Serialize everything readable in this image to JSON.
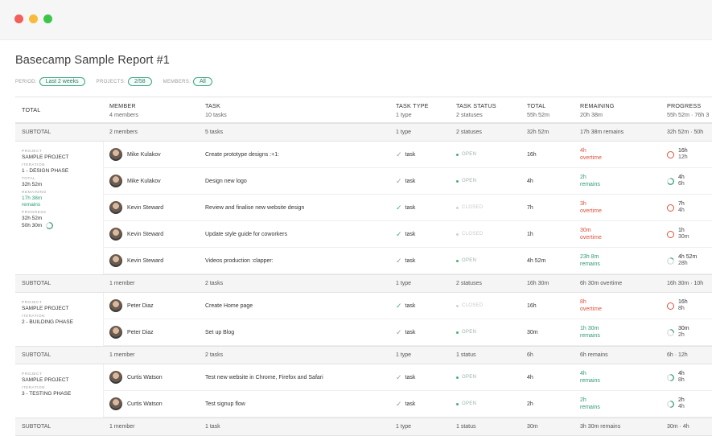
{
  "window": {
    "title": "Basecamp Sample Report #1"
  },
  "filters": [
    {
      "label": "PERIOD:",
      "value": "Last 2 weeks"
    },
    {
      "label": "PROJECTS:",
      "value": "2/58"
    },
    {
      "label": "MEMBERS:",
      "value": "All"
    }
  ],
  "header": {
    "total": "TOTAL",
    "member": {
      "title": "MEMBER",
      "sub": "4 members"
    },
    "task": {
      "title": "TASK",
      "sub": "10 tasks"
    },
    "task_type": {
      "title": "TASK TYPE",
      "sub": "1 type"
    },
    "task_status": {
      "title": "TASK STATUS",
      "sub": "2 statuses"
    },
    "total_col": {
      "title": "TOTAL",
      "sub": "55h 52m"
    },
    "remaining": {
      "title": "REMAINING",
      "sub": "20h 38m"
    },
    "progress": {
      "title": "PROGRESS",
      "sub": "55h 52m · 76h 3"
    }
  },
  "top_subtotal": {
    "label": "SUBTOTAL",
    "member": "2 members",
    "task": "5 tasks",
    "type": "1 type",
    "status": "2 statuses",
    "total": "32h 52m",
    "remaining": "17h 38m remains",
    "progress": "32h 52m · 50h"
  },
  "side_labels": {
    "project": "PROJECT",
    "iteration": "ITERATION",
    "total": "TOTAL",
    "remaining": "REMAINING",
    "progress": "PROGRESS"
  },
  "groups": [
    {
      "project": "SAMPLE PROJECT",
      "iteration": "1 - DESIGN PHASE",
      "total": "32h 52m",
      "remaining": [
        "17h 38m",
        "remains"
      ],
      "progress": [
        "32h 52m",
        "50h 30m"
      ],
      "progress_fraction": 0.65,
      "rows": [
        {
          "member": "Mike Kulakov",
          "task": "Create prototype designs :+1:",
          "type": "task",
          "done": false,
          "status": "OPEN",
          "total": "16h",
          "rem": [
            "4h",
            "overtime"
          ],
          "rem_state": "over",
          "prog": [
            "16h",
            "12h"
          ],
          "prog_fraction": 1.0
        },
        {
          "member": "Mike Kulakov",
          "task": "Design new logo",
          "type": "task",
          "done": false,
          "status": "OPEN",
          "total": "4h",
          "rem": [
            "2h",
            "remains"
          ],
          "rem_state": "ok",
          "prog": [
            "4h",
            "6h"
          ],
          "prog_fraction": 0.67
        },
        {
          "member": "Kevin Steward",
          "task": "Review and finalise new website design",
          "type": "task",
          "done": true,
          "status": "CLOSED",
          "total": "7h",
          "rem": [
            "3h",
            "overtime"
          ],
          "rem_state": "over",
          "prog": [
            "7h",
            "4h"
          ],
          "prog_fraction": 1.0
        },
        {
          "member": "Kevin Steward",
          "task": "Update style guide for coworkers",
          "type": "task",
          "done": true,
          "status": "CLOSED",
          "total": "1h",
          "rem": [
            "30m",
            "overtime"
          ],
          "rem_state": "over",
          "prog": [
            "1h",
            "30m"
          ],
          "prog_fraction": 1.0
        },
        {
          "member": "Kevin Steward",
          "task": "Videos production :clapper:",
          "type": "task",
          "done": false,
          "status": "OPEN",
          "total": "4h 52m",
          "rem": [
            "23h 8m",
            "remains"
          ],
          "rem_state": "ok",
          "prog": [
            "4h 52m",
            "28h"
          ],
          "prog_fraction": 0.17
        }
      ],
      "subtotal": {
        "label": "SUBTOTAL",
        "member": "1 member",
        "task": "2 tasks",
        "type": "1 type",
        "status": "2 statuses",
        "total": "16h 30m",
        "remaining": "6h 30m overtime",
        "progress": "16h 30m · 10h"
      }
    },
    {
      "project": "SAMPLE PROJECT",
      "iteration": "2 - BUILDING PHASE",
      "rows": [
        {
          "member": "Peter Diaz",
          "task": "Create Home page",
          "type": "task",
          "done": true,
          "status": "CLOSED",
          "total": "16h",
          "rem": [
            "8h",
            "overtime"
          ],
          "rem_state": "over",
          "prog": [
            "16h",
            "8h"
          ],
          "prog_fraction": 1.0
        },
        {
          "member": "Peter Diaz",
          "task": "Set up Blog",
          "type": "task",
          "done": false,
          "status": "OPEN",
          "total": "30m",
          "rem": [
            "1h 30m",
            "remains"
          ],
          "rem_state": "ok",
          "prog": [
            "30m",
            "2h"
          ],
          "prog_fraction": 0.25
        }
      ],
      "subtotal": {
        "label": "SUBTOTAL",
        "member": "1 member",
        "task": "2 tasks",
        "type": "1 type",
        "status": "1 status",
        "total": "6h",
        "remaining": "6h remains",
        "progress": "6h · 12h"
      }
    },
    {
      "project": "SAMPLE PROJECT",
      "iteration": "3 - TESTING PHASE",
      "rows": [
        {
          "member": "Curtis Watson",
          "task": "Test new website in Chrome, Firefox and Safari",
          "type": "task",
          "done": false,
          "status": "OPEN",
          "total": "4h",
          "rem": [
            "4h",
            "remains"
          ],
          "rem_state": "ok",
          "prog": [
            "4h",
            "8h"
          ],
          "prog_fraction": 0.5
        },
        {
          "member": "Curtis Watson",
          "task": "Test signup flow",
          "type": "task",
          "done": false,
          "status": "OPEN",
          "total": "2h",
          "rem": [
            "2h",
            "remains"
          ],
          "rem_state": "ok",
          "prog": [
            "2h",
            "4h"
          ],
          "prog_fraction": 0.5
        }
      ],
      "subtotal": {
        "label": "SUBTOTAL",
        "member": "1 member",
        "task": "1 task",
        "type": "1 type",
        "status": "1 status",
        "total": "30m",
        "remaining": "3h 30m remains",
        "progress": "30m · 4h"
      }
    }
  ],
  "colors": {
    "accent": "#3aa686",
    "overtime": "#e0503b",
    "remains": "#2e9a72"
  }
}
